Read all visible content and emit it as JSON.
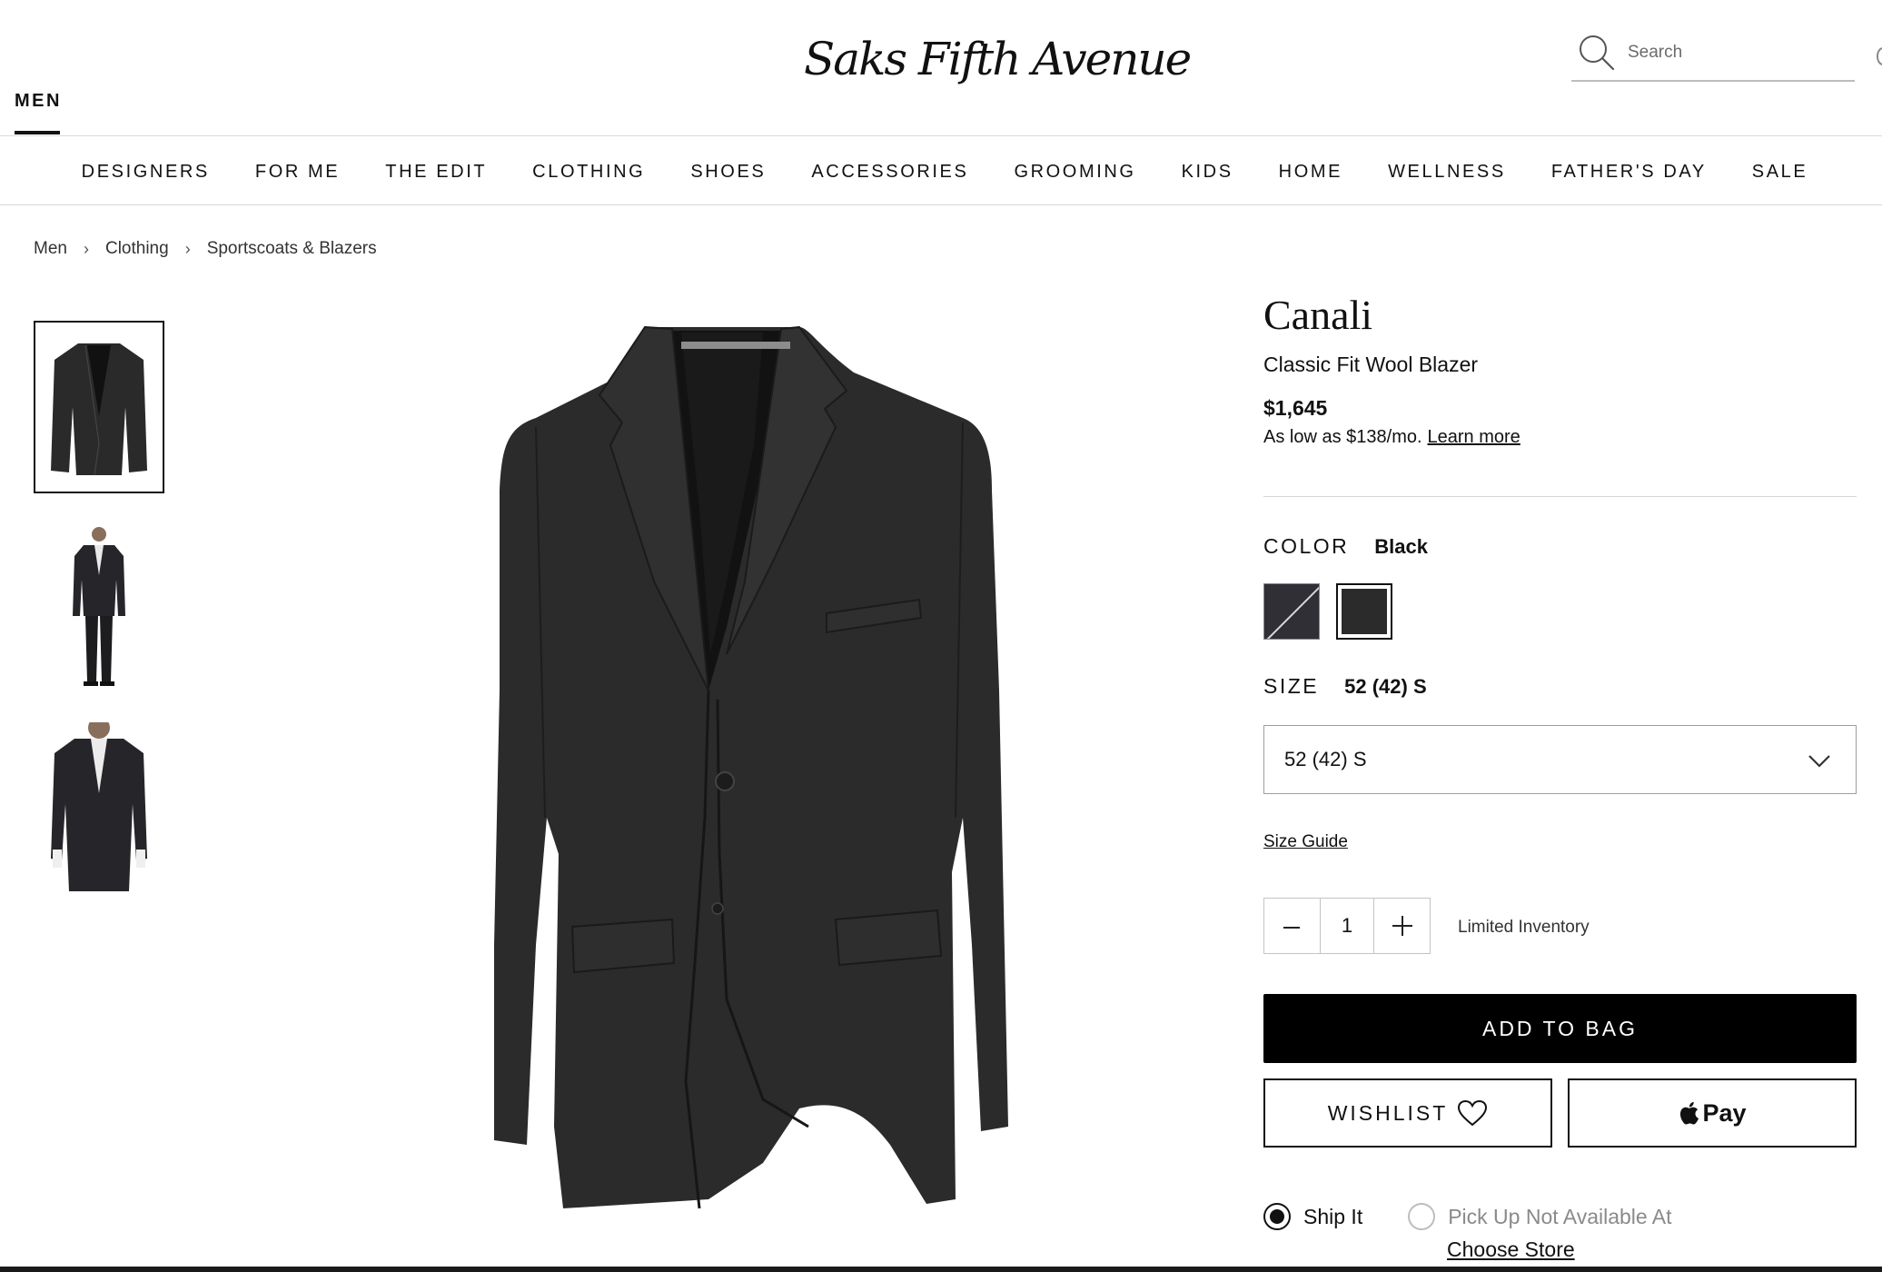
{
  "header": {
    "section_tab": "MEN",
    "logo_text": "Saks Fifth Avenue",
    "search_placeholder": "Search"
  },
  "nav": {
    "items": [
      "DESIGNERS",
      "FOR ME",
      "THE EDIT",
      "CLOTHING",
      "SHOES",
      "ACCESSORIES",
      "GROOMING",
      "KIDS",
      "HOME",
      "WELLNESS",
      "FATHER'S DAY",
      "SALE"
    ]
  },
  "breadcrumb": {
    "items": [
      "Men",
      "Clothing",
      "Sportscoats & Blazers"
    ],
    "separator": "›"
  },
  "product": {
    "brand": "Canali",
    "name": "Classic Fit Wool Blazer",
    "price": "$1,645",
    "finance_text": "As low as $138/mo.",
    "finance_link": "Learn more",
    "color_label": "COLOR",
    "color_value": "Black",
    "swatches": [
      "unavailable",
      "Black"
    ],
    "size_label": "SIZE",
    "size_value": "52 (42) S",
    "size_select_value": "52 (42) S",
    "size_guide": "Size Guide",
    "quantity": "1",
    "inventory_text": "Limited Inventory",
    "add_to_bag": "ADD TO BAG",
    "wishlist": "WISHLIST",
    "apple_pay": "Pay",
    "ship_option": "Ship It",
    "pickup_option": "Pick Up Not Available At",
    "choose_store": "Choose Store"
  },
  "colors": {
    "primary": "#000000",
    "text": "#111111",
    "muted": "#8a8a8a",
    "border": "#d9d9d9"
  }
}
